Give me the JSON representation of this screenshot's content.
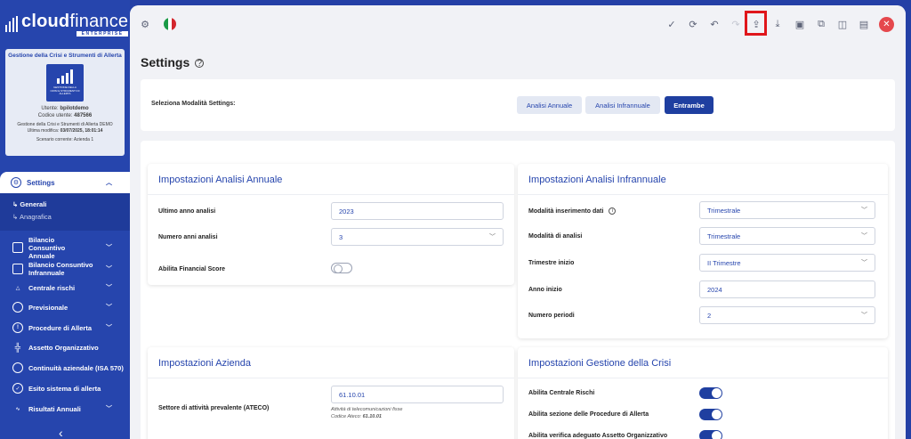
{
  "brand": {
    "name_bold": "cloud",
    "name_light": "finance",
    "edition": "ENTERPRISE"
  },
  "user_card": {
    "title": "Gestione della Crisi e Strumenti di Allerta",
    "logo_caption": "GESTIONE DELLA CRISI E STRUMENTI DI ALLERTA",
    "user_label": "Utente:",
    "user_value": "bpilotdemo",
    "code_label": "Codice utente:",
    "code_value": "487566",
    "project": "Gestione della Crisi e Strumenti di Allerta DEMO",
    "last_mod_label": "Ultima modifica:",
    "last_mod_value": "03/07/2025, 18:01:14",
    "scenario": "Scenario corrente: Azienda 1"
  },
  "sidebar": {
    "active": "Settings",
    "subitems": [
      "Generali",
      "Anagrafica"
    ],
    "items": [
      {
        "label": "Bilancio Consuntivo Annuale",
        "icon": "document-icon",
        "chevron": true
      },
      {
        "label": "Bilancio Consuntivo Infrannuale",
        "icon": "document-icon",
        "chevron": true
      },
      {
        "label": "Centrale rischi",
        "icon": "warning-icon",
        "chevron": true
      },
      {
        "label": "Previsionale",
        "icon": "stopwatch-icon",
        "chevron": true
      },
      {
        "label": "Procedure di Allerta",
        "icon": "alert-circle-icon",
        "chevron": true
      },
      {
        "label": "Assetto Organizzativo",
        "icon": "org-chart-icon",
        "chevron": false
      },
      {
        "label": "Continuità aziendale (ISA 570)",
        "icon": "database-icon",
        "chevron": false
      },
      {
        "label": "Esito sistema di allerta",
        "icon": "check-circle-icon",
        "chevron": false
      },
      {
        "label": "Risultati Annuali",
        "icon": "pulse-icon",
        "chevron": true
      }
    ]
  },
  "page": {
    "title": "Settings"
  },
  "mode": {
    "label": "Seleziona Modalità Settings:",
    "buttons": [
      "Analisi Annuale",
      "Analisi Infrannuale",
      "Entrambe"
    ],
    "selected": "Entrambe"
  },
  "annual": {
    "title": "Impostazioni Analisi Annuale",
    "last_year_label": "Ultimo anno analisi",
    "last_year_value": "2023",
    "num_years_label": "Numero anni analisi",
    "num_years_value": "3",
    "financial_score_label": "Abilita Financial Score"
  },
  "interim": {
    "title": "Impostazioni Analisi Infrannuale",
    "input_mode_label": "Modalità inserimento dati",
    "input_mode_value": "Trimestrale",
    "analysis_mode_label": "Modalità di analisi",
    "analysis_mode_value": "Trimestrale",
    "start_quarter_label": "Trimestre inizio",
    "start_quarter_value": "II Trimestre",
    "start_year_label": "Anno inizio",
    "start_year_value": "2024",
    "periods_label": "Numero periodi",
    "periods_value": "2"
  },
  "company": {
    "title": "Impostazioni Azienda",
    "ateco_label": "Settore di attività prevalente (ATECO)",
    "ateco_value": "61.10.01",
    "ateco_desc": "Attività di telecomunicazioni fisse",
    "ateco_code_label": "Codice Ateco:",
    "ateco_code_value": "61.10.01"
  },
  "crisis": {
    "title": "Impostazioni Gestione della Crisi",
    "centrale_rischi_label": "Abilita Centrale Rischi",
    "procedure_label": "Abilita sezione delle Procedure di Allerta",
    "assetto_label": "Abilita verifica adeguato Assetto Organizzativo"
  },
  "colors": {
    "primary": "#2645ad",
    "danger": "#e5484d",
    "highlight": "#e0161b"
  }
}
